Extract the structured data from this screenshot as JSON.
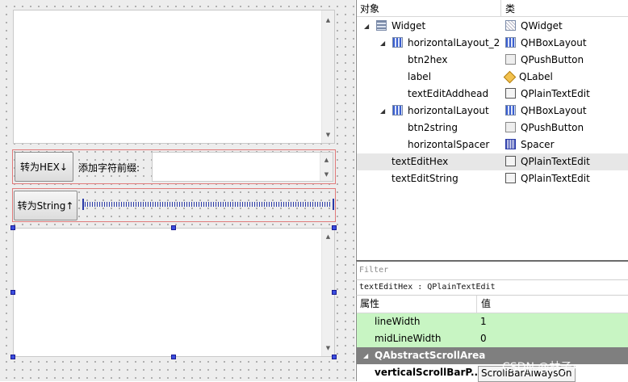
{
  "form": {
    "btn2hex_label": "转为HEX↓",
    "addhead_label": "添加字符前缀:",
    "btn2string_label": "转为String↑"
  },
  "object_inspector": {
    "col_object": "对象",
    "col_class": "类",
    "rows": [
      {
        "name": "Widget",
        "cls": "QWidget"
      },
      {
        "name": "horizontalLayout_2",
        "cls": "QHBoxLayout"
      },
      {
        "name": "btn2hex",
        "cls": "QPushButton"
      },
      {
        "name": "label",
        "cls": "QLabel"
      },
      {
        "name": "textEditAddhead",
        "cls": "QPlainTextEdit"
      },
      {
        "name": "horizontalLayout",
        "cls": "QHBoxLayout"
      },
      {
        "name": "btn2string",
        "cls": "QPushButton"
      },
      {
        "name": "horizontalSpacer",
        "cls": "Spacer"
      },
      {
        "name": "textEditHex",
        "cls": "QPlainTextEdit"
      },
      {
        "name": "textEditString",
        "cls": "QPlainTextEdit"
      }
    ]
  },
  "property_editor": {
    "filter_placeholder": "Filter",
    "object_class": "textEditHex : QPlainTextEdit",
    "col_property": "属性",
    "col_value": "值",
    "rows": [
      {
        "name": "lineWidth",
        "value": "1"
      },
      {
        "name": "midLineWidth",
        "value": "0"
      },
      {
        "name": "QAbstractScrollArea",
        "value": ""
      },
      {
        "name": "verticalScrollBarP...",
        "value": "ScrollBarAlwaysOn"
      }
    ]
  },
  "watermark": "CSDN @林子xxx"
}
